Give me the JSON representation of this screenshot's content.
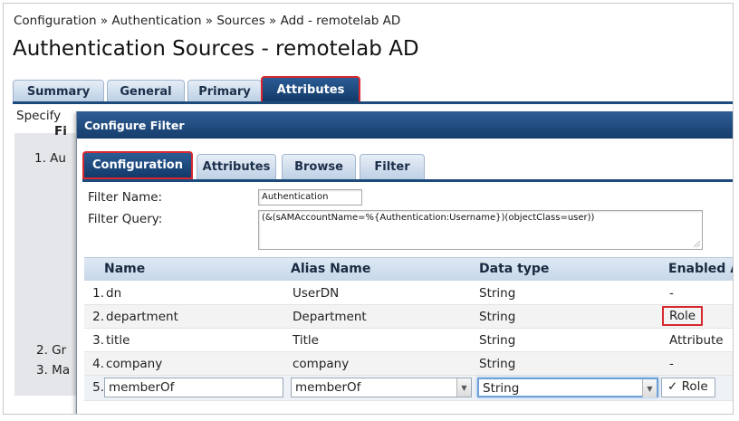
{
  "breadcrumb": "Configuration » Authentication » Sources » Add - remotelab AD",
  "page_title": "Authentication Sources - remotelab AD",
  "outer_tabs": [
    {
      "label": "Summary"
    },
    {
      "label": "General"
    },
    {
      "label": "Primary"
    },
    {
      "label": "Attributes"
    }
  ],
  "background": {
    "specify": "Specify",
    "fi": "Fi",
    "item1": "1. Au",
    "item2": "2. Gr",
    "item3": "3. Ma"
  },
  "dialog": {
    "title": "Configure Filter",
    "tabs": [
      {
        "label": "Configuration"
      },
      {
        "label": "Attributes"
      },
      {
        "label": "Browse"
      },
      {
        "label": "Filter"
      }
    ],
    "filter_name_label": "Filter Name:",
    "filter_name_value": "Authentication",
    "filter_query_label": "Filter Query:",
    "filter_query_value": "(&(sAMAccountName=%{Authentication:Username})(objectClass=user))",
    "columns": [
      "Name",
      "Alias Name",
      "Data type",
      "Enabled A"
    ],
    "rows": [
      {
        "index": "1.",
        "name": "dn",
        "alias": "UserDN",
        "type": "String",
        "enabled": "-"
      },
      {
        "index": "2.",
        "name": "department",
        "alias": "Department",
        "type": "String",
        "enabled": "Role"
      },
      {
        "index": "3.",
        "name": "title",
        "alias": "Title",
        "type": "String",
        "enabled": "Attribute"
      },
      {
        "index": "4.",
        "name": "company",
        "alias": "company",
        "type": "String",
        "enabled": "-"
      },
      {
        "index": "5.",
        "name": "memberOf",
        "alias": "memberOf",
        "type": "String",
        "enabled": "✓ Role"
      }
    ]
  },
  "colors": {
    "tab_active": "#1d4a7d",
    "highlight": "#d7282f",
    "header_bar": "#163d6c"
  }
}
